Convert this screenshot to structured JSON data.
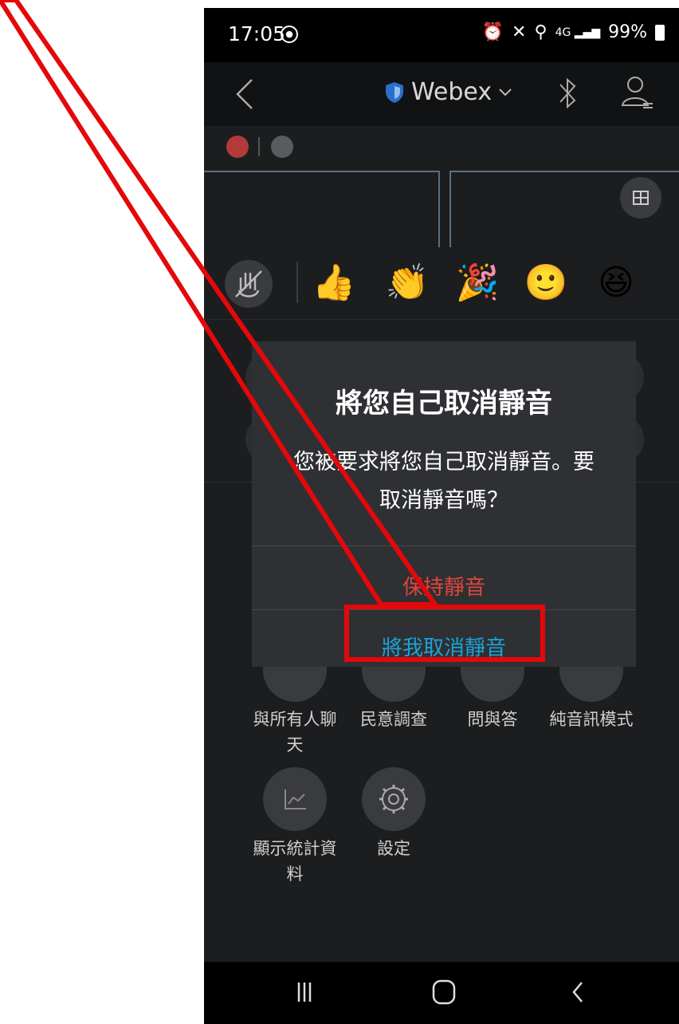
{
  "status_bar": {
    "time": "17:05",
    "battery": "99%"
  },
  "app_bar": {
    "brand": "Webex"
  },
  "dialog": {
    "title": "將您自己取消靜音",
    "message_line1": "您被要求將您自己取消靜音。要",
    "message_line2": "取消靜音嗎？",
    "keep_muted": "保持靜音",
    "unmute": "將我取消靜音"
  },
  "menu": {
    "items": [
      {
        "label_line1": "與所有人聊",
        "label_line2": "天"
      },
      {
        "label_line1": "民意調查",
        "label_line2": ""
      },
      {
        "label_line1": "問與答",
        "label_line2": ""
      },
      {
        "label_line1": "純音訊模式",
        "label_line2": ""
      },
      {
        "label_line1": "顯示統計資",
        "label_line2": "料"
      },
      {
        "label_line1": "設定",
        "label_line2": ""
      }
    ]
  },
  "colors": {
    "keep_muted": "#e0463c",
    "unmute": "#1aa3d8",
    "callout": "#e4080a"
  }
}
